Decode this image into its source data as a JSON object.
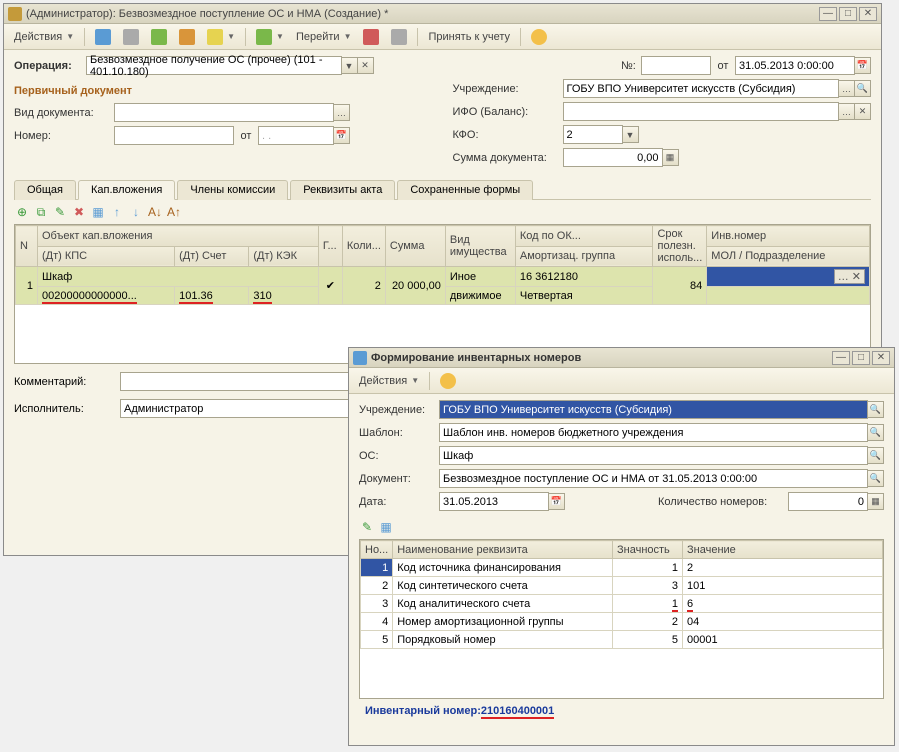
{
  "win1": {
    "title": "(Администратор): Безвозмездное поступление ОС и НМА (Создание) *",
    "toolbar": {
      "actions": "Действия",
      "goto": "Перейти",
      "accept": "Принять к учету"
    },
    "op_label": "Операция:",
    "op_value": "Безвозмездное получение ОС (прочее) (101 - 401.10.180)",
    "num_label": "№:",
    "ot_label": "от",
    "date_value": "31.05.2013 0:00:00",
    "section_primary": "Первичный документ",
    "left": {
      "docType": "Вид документа:",
      "number": "Номер:",
      "ot": "от",
      "dotval": ". ."
    },
    "right": {
      "org": "Учреждение:",
      "org_val": "ГОБУ ВПО Университет искусств (Субсидия)",
      "ifo": "ИФО (Баланс):",
      "kfo": "КФО:",
      "kfo_val": "2",
      "sum": "Сумма документа:",
      "sum_val": "0,00"
    },
    "tabs": [
      "Общая",
      "Кап.вложения",
      "Члены комиссии",
      "Реквизиты акта",
      "Сохраненные формы"
    ],
    "grid": {
      "headers": {
        "n": "N",
        "obj": "Объект кап.вложения",
        "g": "Г...",
        "kol": "Коли...",
        "sum": "Сумма",
        "vid": "Вид имущества",
        "kod": "Код по ОК...",
        "srok": "Срок полезн. исполь...",
        "inv": "Инв.номер",
        "kps": "(Дт) КПС",
        "schet": "(Дт) Счет",
        "kek": "(Дт) КЭК",
        "amort": "Амортизац. группа",
        "mol": "МОЛ / Подразделение"
      },
      "row": {
        "n": "1",
        "obj": "Шкаф",
        "kol": "2",
        "sum": "20 000,00",
        "vid1": "Иное",
        "vid2": "движимое",
        "kod": "16 3612180",
        "srok": "84",
        "kps": "00200000000000...",
        "schet": "101.36",
        "kek": "310",
        "amort": "Четвертая"
      }
    },
    "comment": "Комментарий:",
    "exec": "Исполнитель:",
    "exec_val": "Администратор"
  },
  "win2": {
    "title": "Формирование инвентарных номеров",
    "actions": "Действия",
    "org": "Учреждение:",
    "org_val": "ГОБУ ВПО Университет искусств (Субсидия)",
    "tmpl": "Шаблон:",
    "tmpl_val": "Шаблон инв. номеров бюджетного учреждения",
    "os": "ОС:",
    "os_val": "Шкаф",
    "doc": "Документ:",
    "doc_val": "Безвозмездное поступление ОС и НМА  от 31.05.2013 0:00:00",
    "date": "Дата:",
    "date_val": "31.05.2013",
    "qty": "Количество номеров:",
    "qty_val": "0",
    "grid": {
      "h": {
        "n": "Но...",
        "name": "Наименование реквизита",
        "zn": "Значность",
        "val": "Значение"
      },
      "rows": [
        {
          "n": "1",
          "name": "Код источника финансирования",
          "zn": "1",
          "val": "2"
        },
        {
          "n": "2",
          "name": "Код синтетического счета",
          "zn": "3",
          "val": "101"
        },
        {
          "n": "3",
          "name": "Код аналитического счета",
          "zn": "1",
          "val": "6"
        },
        {
          "n": "4",
          "name": "Номер амортизационной группы",
          "zn": "2",
          "val": "04"
        },
        {
          "n": "5",
          "name": "Порядковый номер",
          "zn": "5",
          "val": "00001"
        }
      ]
    },
    "inv_label": "Инвентарный номер:",
    "inv_val": "210160400001"
  }
}
